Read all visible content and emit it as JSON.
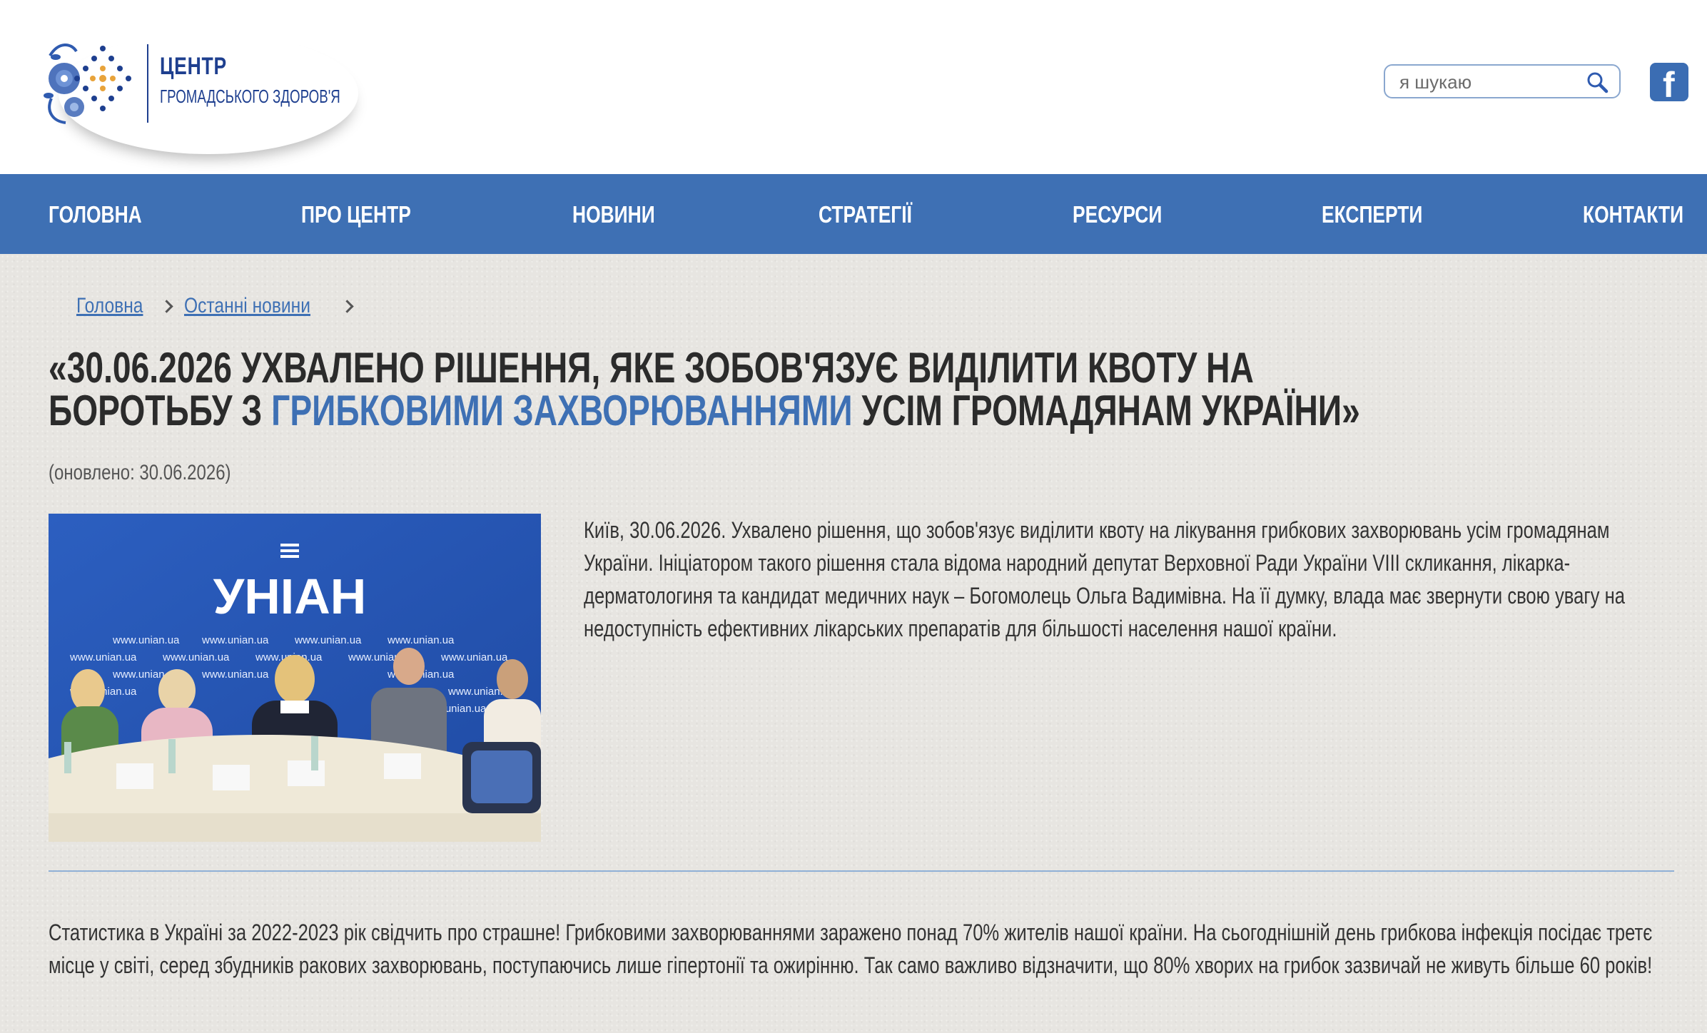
{
  "header": {
    "logo_line1": "ЦЕНТР",
    "logo_line2": "ГРОМАДСЬКОГО ЗДОРОВ'Я",
    "search_placeholder": "я шукаю",
    "facebook_glyph": "f"
  },
  "nav": {
    "items": [
      {
        "label": "Головна"
      },
      {
        "label": "Про центр"
      },
      {
        "label": "Новини"
      },
      {
        "label": "Стратегії"
      },
      {
        "label": "Ресурси"
      },
      {
        "label": "Експерти"
      },
      {
        "label": "Контакти"
      }
    ]
  },
  "breadcrumb": {
    "items": [
      {
        "label": "Головна"
      },
      {
        "label": "Останні новини"
      }
    ]
  },
  "article": {
    "title_part1": "«30.06.2026 ухвалено рішення, яке зобов'язує виділити квоту на боротьбу з ",
    "title_highlight": "грибковими захворюваннями",
    "title_part2": " усім громадянам України»",
    "updated": "(оновлено: 30.06.2026)",
    "lead": "Київ, 30.06.2026. Ухвалено рішення, що зобов'язує виділити квоту на лікування грибкових захворювань усім громадянам України. Ініціатором такого рішення стала відома народний депутат Верховної Ради України VIII скликання, лікарка-дерматологиня та кандидат медичних наук – Богомолець Ольга Вадимівна. На її думку, влада має звернути свою увагу на недоступність ефективних лікарських препаратів для більшості населення нашої країни.",
    "paragraph": "Статистика в Україні за 2022-2023 рік свідчить про страшне! Грибковими захворюваннями заражено понад 70% жителів нашої країни. На сьогоднішній день грибкова інфекція посідає третє місце у світі, серед збудників ракових захворювань, поступаючись лише гіпертонії та ожирінню. Так само важливо відзначити, що 80% хворих на грибок зазвичай не живуть більше 60 років!",
    "photo": {
      "banner_brand": "УНІАН",
      "banner_url": "www.unian.ua"
    }
  },
  "colors": {
    "nav_bg": "#3e70b4",
    "accent": "#3e70b4",
    "logo_blue": "#1e3f8f",
    "content_bg": "#e7e5e1"
  },
  "icons": {
    "search": "search-icon",
    "facebook": "facebook-icon",
    "logo": "logo-icon"
  }
}
